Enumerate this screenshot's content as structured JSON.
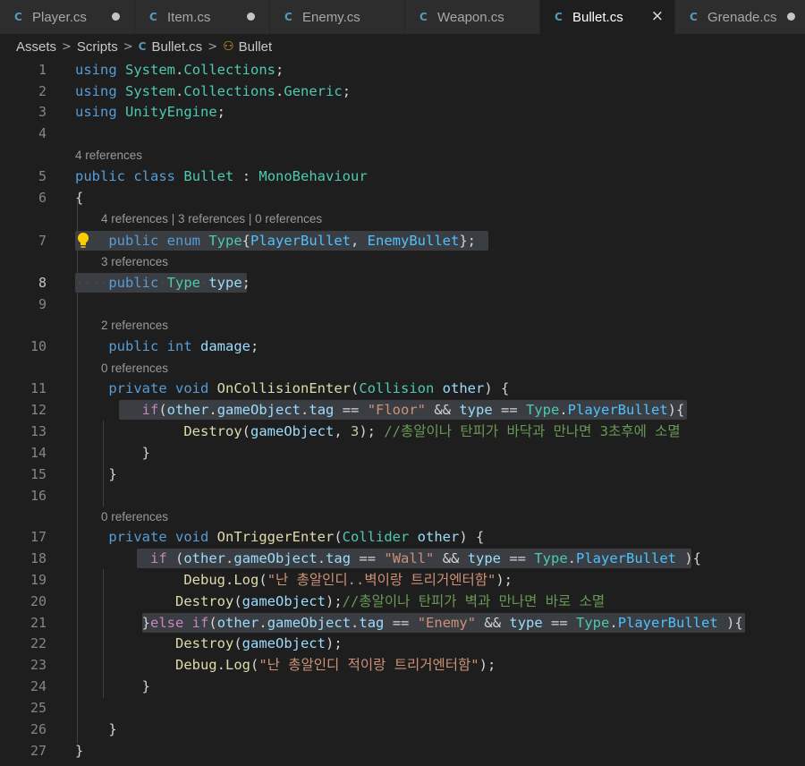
{
  "tabs": [
    {
      "label": "Player.cs",
      "state": "modified"
    },
    {
      "label": "Item.cs",
      "state": "modified"
    },
    {
      "label": "Enemy.cs",
      "state": "normal"
    },
    {
      "label": "Weapon.cs",
      "state": "normal"
    },
    {
      "label": "Bullet.cs",
      "state": "active"
    },
    {
      "label": "Grenade.cs",
      "state": "modified"
    }
  ],
  "icons": {
    "csharp": "csharp-file-icon",
    "class": "class-symbol-icon",
    "bulb": "lightbulb-icon",
    "close": "close-icon",
    "dirty": "unsaved-dot-icon",
    "colors": {
      "csharp": "#519aba",
      "class": "#ee9d28",
      "bulb": "#ffcc00"
    }
  },
  "breadcrumb": {
    "items": [
      "Assets",
      "Scripts",
      "Bullet.cs",
      "Bullet"
    ]
  },
  "code_lens": {
    "l5": "4 references",
    "l7": "4 references | 3 references | 0 references",
    "l8": "3 references",
    "l10": "2 references",
    "l11": "0 references",
    "l17": "0 references"
  },
  "lines": [
    {
      "n": "1",
      "tokens": [
        [
          "kw",
          "using"
        ],
        [
          "pl",
          " "
        ],
        [
          "ns",
          "System"
        ],
        [
          "pl",
          "."
        ],
        [
          "ns",
          "Collections"
        ],
        [
          "pl",
          ";"
        ]
      ]
    },
    {
      "n": "2",
      "tokens": [
        [
          "kw",
          "using"
        ],
        [
          "pl",
          " "
        ],
        [
          "ns",
          "System"
        ],
        [
          "pl",
          "."
        ],
        [
          "ns",
          "Collections"
        ],
        [
          "pl",
          "."
        ],
        [
          "ns",
          "Generic"
        ],
        [
          "pl",
          ";"
        ]
      ]
    },
    {
      "n": "3",
      "tokens": [
        [
          "kw",
          "using"
        ],
        [
          "pl",
          " "
        ],
        [
          "ns",
          "UnityEngine"
        ],
        [
          "pl",
          ";"
        ]
      ]
    },
    {
      "n": "4",
      "tokens": []
    },
    {
      "n": "5",
      "tokens": [
        [
          "kw",
          "public"
        ],
        [
          "pl",
          " "
        ],
        [
          "kw",
          "class"
        ],
        [
          "pl",
          " "
        ],
        [
          "ty",
          "Bullet"
        ],
        [
          "pl",
          " : "
        ],
        [
          "ty",
          "MonoBehaviour"
        ]
      ]
    },
    {
      "n": "6",
      "tokens": [
        [
          "pl",
          "{"
        ]
      ]
    },
    {
      "n": "7",
      "tokens": [
        [
          "pl",
          "    "
        ],
        [
          "kw",
          "public"
        ],
        [
          "pl",
          " "
        ],
        [
          "kw",
          "enum"
        ],
        [
          "pl",
          " "
        ],
        [
          "ty",
          "Type"
        ],
        [
          "pl",
          "{"
        ],
        [
          "em",
          "PlayerBullet"
        ],
        [
          "pl",
          ", "
        ],
        [
          "em",
          "EnemyBullet"
        ],
        [
          "pl",
          "};"
        ]
      ]
    },
    {
      "n": "8",
      "tokens": [
        [
          "ws",
          "····"
        ],
        [
          "kw",
          "public"
        ],
        [
          "ws",
          "·"
        ],
        [
          "ty",
          "Type"
        ],
        [
          "ws",
          "·"
        ],
        [
          "var",
          "type"
        ],
        [
          "pl",
          ";"
        ]
      ]
    },
    {
      "n": "9",
      "tokens": []
    },
    {
      "n": "10",
      "tokens": [
        [
          "pl",
          "    "
        ],
        [
          "kw",
          "public"
        ],
        [
          "pl",
          " "
        ],
        [
          "kw",
          "int"
        ],
        [
          "pl",
          " "
        ],
        [
          "var",
          "damage"
        ],
        [
          "pl",
          ";"
        ]
      ]
    },
    {
      "n": "11",
      "tokens": [
        [
          "pl",
          "    "
        ],
        [
          "kw",
          "private"
        ],
        [
          "pl",
          " "
        ],
        [
          "kw",
          "void"
        ],
        [
          "pl",
          " "
        ],
        [
          "fn",
          "OnCollisionEnter"
        ],
        [
          "pl",
          "("
        ],
        [
          "ty",
          "Collision"
        ],
        [
          "pl",
          " "
        ],
        [
          "var",
          "other"
        ],
        [
          "pl",
          ") {"
        ]
      ]
    },
    {
      "n": "12",
      "tokens": [
        [
          "pl",
          "        "
        ],
        [
          "ctl",
          "if"
        ],
        [
          "pl",
          "("
        ],
        [
          "var",
          "other"
        ],
        [
          "pl",
          "."
        ],
        [
          "var",
          "gameObject"
        ],
        [
          "pl",
          "."
        ],
        [
          "var",
          "tag"
        ],
        [
          "pl",
          " == "
        ],
        [
          "str",
          "\"Floor\""
        ],
        [
          "pl",
          " && "
        ],
        [
          "var",
          "type"
        ],
        [
          "pl",
          " == "
        ],
        [
          "ty",
          "Type"
        ],
        [
          "pl",
          "."
        ],
        [
          "em",
          "PlayerBullet"
        ],
        [
          "pl",
          "){"
        ]
      ]
    },
    {
      "n": "13",
      "tokens": [
        [
          "pl",
          "             "
        ],
        [
          "fn",
          "Destroy"
        ],
        [
          "pl",
          "("
        ],
        [
          "var",
          "gameObject"
        ],
        [
          "pl",
          ", "
        ],
        [
          "num",
          "3"
        ],
        [
          "pl",
          "); "
        ],
        [
          "cmt",
          "//총알이나 탄피가 바닥과 만나면 3초후에 소멸"
        ]
      ]
    },
    {
      "n": "14",
      "tokens": [
        [
          "pl",
          "        }"
        ]
      ]
    },
    {
      "n": "15",
      "tokens": [
        [
          "pl",
          "    }"
        ]
      ]
    },
    {
      "n": "16",
      "tokens": []
    },
    {
      "n": "17",
      "tokens": [
        [
          "pl",
          "    "
        ],
        [
          "kw",
          "private"
        ],
        [
          "pl",
          " "
        ],
        [
          "kw",
          "void"
        ],
        [
          "pl",
          " "
        ],
        [
          "fn",
          "OnTriggerEnter"
        ],
        [
          "pl",
          "("
        ],
        [
          "ty",
          "Collider"
        ],
        [
          "pl",
          " "
        ],
        [
          "var",
          "other"
        ],
        [
          "pl",
          ") {"
        ]
      ]
    },
    {
      "n": "18",
      "tokens": [
        [
          "pl",
          "         "
        ],
        [
          "ctl",
          "if"
        ],
        [
          "pl",
          " ("
        ],
        [
          "var",
          "other"
        ],
        [
          "pl",
          "."
        ],
        [
          "var",
          "gameObject"
        ],
        [
          "pl",
          "."
        ],
        [
          "var",
          "tag"
        ],
        [
          "pl",
          " == "
        ],
        [
          "str",
          "\"Wall\""
        ],
        [
          "pl",
          " && "
        ],
        [
          "var",
          "type"
        ],
        [
          "pl",
          " == "
        ],
        [
          "ty",
          "Type"
        ],
        [
          "pl",
          "."
        ],
        [
          "em",
          "PlayerBullet"
        ],
        [
          "pl",
          " ){"
        ]
      ]
    },
    {
      "n": "19",
      "tokens": [
        [
          "pl",
          "             "
        ],
        [
          "fn",
          "Debug"
        ],
        [
          "pl",
          "."
        ],
        [
          "fn",
          "Log"
        ],
        [
          "pl",
          "("
        ],
        [
          "str",
          "\"난 총알인디..벽이랑 트리거엔터함\""
        ],
        [
          "pl",
          ");"
        ]
      ]
    },
    {
      "n": "20",
      "tokens": [
        [
          "pl",
          "            "
        ],
        [
          "fn",
          "Destroy"
        ],
        [
          "pl",
          "("
        ],
        [
          "var",
          "gameObject"
        ],
        [
          "pl",
          ");"
        ],
        [
          "cmt",
          "//총알이나 탄피가 벽과 만나면 바로 소멸"
        ]
      ]
    },
    {
      "n": "21",
      "tokens": [
        [
          "pl",
          "        }"
        ],
        [
          "ctl",
          "else"
        ],
        [
          "pl",
          " "
        ],
        [
          "ctl",
          "if"
        ],
        [
          "pl",
          "("
        ],
        [
          "var",
          "other"
        ],
        [
          "pl",
          "."
        ],
        [
          "var",
          "gameObject"
        ],
        [
          "pl",
          "."
        ],
        [
          "var",
          "tag"
        ],
        [
          "pl",
          " == "
        ],
        [
          "str",
          "\"Enemy\""
        ],
        [
          "pl",
          " && "
        ],
        [
          "var",
          "type"
        ],
        [
          "pl",
          " == "
        ],
        [
          "ty",
          "Type"
        ],
        [
          "pl",
          "."
        ],
        [
          "em",
          "PlayerBullet"
        ],
        [
          "pl",
          " ){"
        ]
      ]
    },
    {
      "n": "22",
      "tokens": [
        [
          "pl",
          "            "
        ],
        [
          "fn",
          "Destroy"
        ],
        [
          "pl",
          "("
        ],
        [
          "var",
          "gameObject"
        ],
        [
          "pl",
          ");"
        ]
      ]
    },
    {
      "n": "23",
      "tokens": [
        [
          "pl",
          "            "
        ],
        [
          "fn",
          "Debug"
        ],
        [
          "pl",
          "."
        ],
        [
          "fn",
          "Log"
        ],
        [
          "pl",
          "("
        ],
        [
          "str",
          "\"난 총알인디 적이랑 트리거엔터함\""
        ],
        [
          "pl",
          ");"
        ]
      ]
    },
    {
      "n": "24",
      "tokens": [
        [
          "pl",
          "        }"
        ]
      ]
    },
    {
      "n": "25",
      "tokens": []
    },
    {
      "n": "26",
      "tokens": [
        [
          "pl",
          "    }"
        ]
      ]
    },
    {
      "n": "27",
      "tokens": [
        [
          "pl",
          "}"
        ]
      ]
    }
  ]
}
